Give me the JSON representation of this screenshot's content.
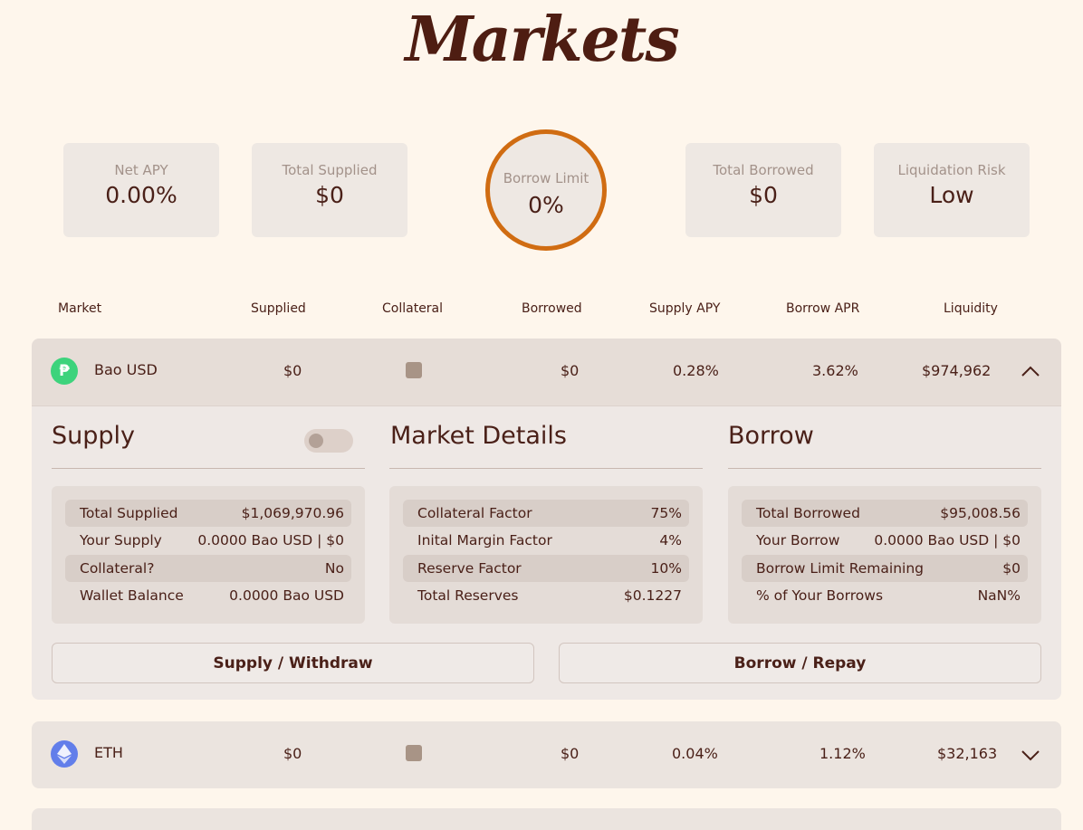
{
  "page": {
    "title": "Markets"
  },
  "stats": {
    "net_apy": {
      "label": "Net APY",
      "value": "0.00%"
    },
    "total_supplied": {
      "label": "Total Supplied",
      "value": "$0"
    },
    "borrow_limit": {
      "label": "Borrow Limit",
      "value": "0%"
    },
    "total_borrowed": {
      "label": "Total Borrowed",
      "value": "$0"
    },
    "liquidation_risk": {
      "label": "Liquidation Risk",
      "value": "Low"
    }
  },
  "columns": [
    "Market",
    "Supplied",
    "Collateral",
    "Borrowed",
    "Supply APY",
    "Borrow APR",
    "Liquidity"
  ],
  "markets": [
    {
      "name": "Bao USD",
      "icon": "bao-usd-icon",
      "icon_color": "#3dd37c",
      "supplied": "$0",
      "collateral": false,
      "borrowed": "$0",
      "supply_apy": "0.28%",
      "borrow_apr": "3.62%",
      "liquidity": "$974,962",
      "expanded": true
    },
    {
      "name": "ETH",
      "icon": "eth-icon",
      "icon_color": "#627eea",
      "supplied": "$0",
      "collateral": false,
      "borrowed": "$0",
      "supply_apy": "0.04%",
      "borrow_apr": "1.12%",
      "liquidity": "$32,163",
      "expanded": false
    }
  ],
  "details": {
    "supply": {
      "title": "Supply",
      "rows": [
        {
          "k": "Total Supplied",
          "v": "$1,069,970.96"
        },
        {
          "k": "Your Supply",
          "v": "0.0000 Bao USD | $0"
        },
        {
          "k": "Collateral?",
          "v": "No"
        },
        {
          "k": "Wallet Balance",
          "v": "0.0000 Bao USD"
        }
      ],
      "button": "Supply / Withdraw"
    },
    "market": {
      "title": "Market Details",
      "rows": [
        {
          "k": "Collateral Factor",
          "v": "75%"
        },
        {
          "k": "Inital Margin Factor",
          "v": "4%"
        },
        {
          "k": "Reserve Factor",
          "v": "10%"
        },
        {
          "k": "Total Reserves",
          "v": "$0.1227"
        }
      ]
    },
    "borrow": {
      "title": "Borrow",
      "rows": [
        {
          "k": "Total Borrowed",
          "v": "$95,008.56"
        },
        {
          "k": "Your Borrow",
          "v": "0.0000 Bao USD | $0"
        },
        {
          "k": "Borrow Limit Remaining",
          "v": "$0"
        },
        {
          "k": "% of Your Borrows",
          "v": "NaN%"
        }
      ],
      "button": "Borrow / Repay"
    }
  },
  "colors": {
    "background": "#fef6ec",
    "accent": "#d06c12",
    "text": "#4a2018"
  }
}
